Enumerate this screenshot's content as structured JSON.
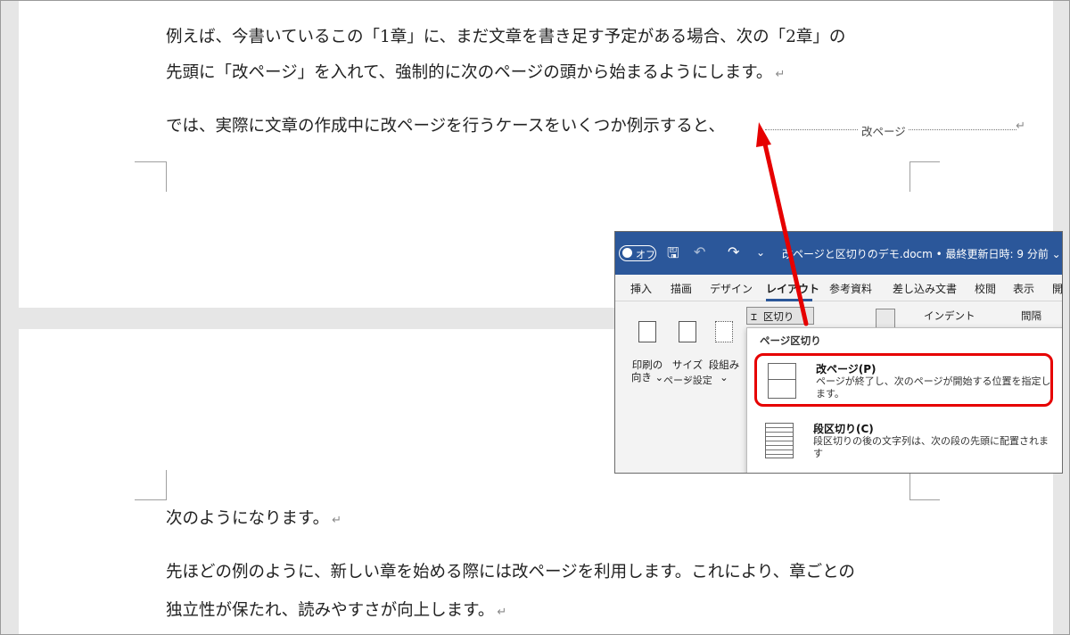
{
  "document": {
    "para1_line1": "例えば、今書いているこの「1章」に、まだ文章を書き足す予定がある場合、次の「2章」の",
    "para1_line2": "先頭に「改ページ」を入れて、強制的に次のページの頭から始まるようにします。",
    "para2": "では、実際に文章の作成中に改ページを行うケースをいくつか例示すると、",
    "page_break_label": "改ページ",
    "para3": "次のようになります。",
    "para4_line1": "先ほどの例のように、新しい章を始める際には改ページを利用します。これにより、章ごとの",
    "para4_line2": "独立性が保たれ、読みやすさが向上します。",
    "return_mark": "↵"
  },
  "word_ui": {
    "autosave_label": "オフ",
    "doc_title": "改ページと区切りのデモ.docm • 最終更新日時: 9 分前 ⌄",
    "tabs": [
      "挿入",
      "描画",
      "デザイン",
      "レイアウト",
      "参考資料",
      "差し込み文書",
      "校閲",
      "表示",
      "開"
    ],
    "active_tab": "レイアウト",
    "ribbon": {
      "orientation_label": "印刷の\n向き ⌄",
      "size_label": "サイズ\n⌄",
      "columns_label": "段組み\n⌄",
      "group_label": "ページ設定",
      "breaks_button": "区切り",
      "indent_label": "インデント",
      "spacing_label": "間隔"
    },
    "breaks_menu": {
      "section_header": "ページ区切り",
      "items": [
        {
          "title": "改ページ(P)",
          "description": "ページが終了し、次のページが開始する位置を指定します。"
        },
        {
          "title": "段区切り(C)",
          "description": "段区切りの後の文字列は、次の段の先頭に配置されます"
        }
      ]
    }
  },
  "colors": {
    "title_bar": "#2b579a",
    "highlight": "#e60000"
  }
}
